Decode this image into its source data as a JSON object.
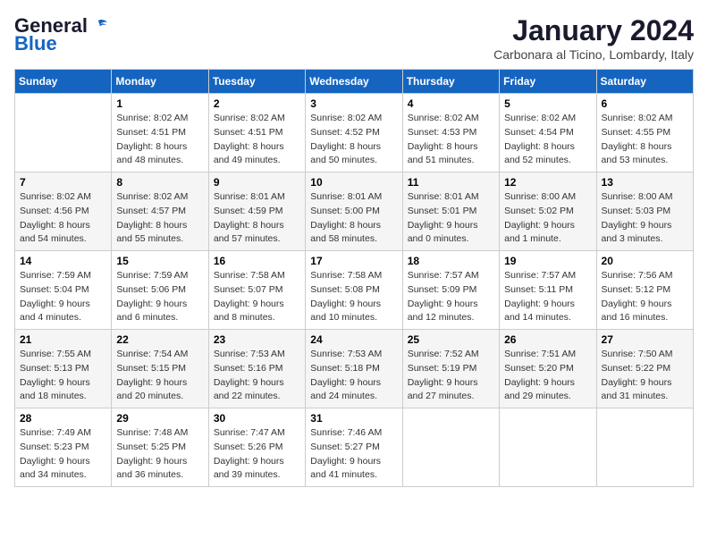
{
  "header": {
    "logo_line1": "General",
    "logo_line2": "Blue",
    "month_title": "January 2024",
    "location": "Carbonara al Ticino, Lombardy, Italy"
  },
  "days_of_week": [
    "Sunday",
    "Monday",
    "Tuesday",
    "Wednesday",
    "Thursday",
    "Friday",
    "Saturday"
  ],
  "weeks": [
    [
      {
        "day": "",
        "sunrise": "",
        "sunset": "",
        "daylight": ""
      },
      {
        "day": "1",
        "sunrise": "8:02 AM",
        "sunset": "4:51 PM",
        "daylight": "8 hours and 48 minutes."
      },
      {
        "day": "2",
        "sunrise": "8:02 AM",
        "sunset": "4:51 PM",
        "daylight": "8 hours and 49 minutes."
      },
      {
        "day": "3",
        "sunrise": "8:02 AM",
        "sunset": "4:52 PM",
        "daylight": "8 hours and 50 minutes."
      },
      {
        "day": "4",
        "sunrise": "8:02 AM",
        "sunset": "4:53 PM",
        "daylight": "8 hours and 51 minutes."
      },
      {
        "day": "5",
        "sunrise": "8:02 AM",
        "sunset": "4:54 PM",
        "daylight": "8 hours and 52 minutes."
      },
      {
        "day": "6",
        "sunrise": "8:02 AM",
        "sunset": "4:55 PM",
        "daylight": "8 hours and 53 minutes."
      }
    ],
    [
      {
        "day": "7",
        "sunrise": "8:02 AM",
        "sunset": "4:56 PM",
        "daylight": "8 hours and 54 minutes."
      },
      {
        "day": "8",
        "sunrise": "8:02 AM",
        "sunset": "4:57 PM",
        "daylight": "8 hours and 55 minutes."
      },
      {
        "day": "9",
        "sunrise": "8:01 AM",
        "sunset": "4:59 PM",
        "daylight": "8 hours and 57 minutes."
      },
      {
        "day": "10",
        "sunrise": "8:01 AM",
        "sunset": "5:00 PM",
        "daylight": "8 hours and 58 minutes."
      },
      {
        "day": "11",
        "sunrise": "8:01 AM",
        "sunset": "5:01 PM",
        "daylight": "9 hours and 0 minutes."
      },
      {
        "day": "12",
        "sunrise": "8:00 AM",
        "sunset": "5:02 PM",
        "daylight": "9 hours and 1 minute."
      },
      {
        "day": "13",
        "sunrise": "8:00 AM",
        "sunset": "5:03 PM",
        "daylight": "9 hours and 3 minutes."
      }
    ],
    [
      {
        "day": "14",
        "sunrise": "7:59 AM",
        "sunset": "5:04 PM",
        "daylight": "9 hours and 4 minutes."
      },
      {
        "day": "15",
        "sunrise": "7:59 AM",
        "sunset": "5:06 PM",
        "daylight": "9 hours and 6 minutes."
      },
      {
        "day": "16",
        "sunrise": "7:58 AM",
        "sunset": "5:07 PM",
        "daylight": "9 hours and 8 minutes."
      },
      {
        "day": "17",
        "sunrise": "7:58 AM",
        "sunset": "5:08 PM",
        "daylight": "9 hours and 10 minutes."
      },
      {
        "day": "18",
        "sunrise": "7:57 AM",
        "sunset": "5:09 PM",
        "daylight": "9 hours and 12 minutes."
      },
      {
        "day": "19",
        "sunrise": "7:57 AM",
        "sunset": "5:11 PM",
        "daylight": "9 hours and 14 minutes."
      },
      {
        "day": "20",
        "sunrise": "7:56 AM",
        "sunset": "5:12 PM",
        "daylight": "9 hours and 16 minutes."
      }
    ],
    [
      {
        "day": "21",
        "sunrise": "7:55 AM",
        "sunset": "5:13 PM",
        "daylight": "9 hours and 18 minutes."
      },
      {
        "day": "22",
        "sunrise": "7:54 AM",
        "sunset": "5:15 PM",
        "daylight": "9 hours and 20 minutes."
      },
      {
        "day": "23",
        "sunrise": "7:53 AM",
        "sunset": "5:16 PM",
        "daylight": "9 hours and 22 minutes."
      },
      {
        "day": "24",
        "sunrise": "7:53 AM",
        "sunset": "5:18 PM",
        "daylight": "9 hours and 24 minutes."
      },
      {
        "day": "25",
        "sunrise": "7:52 AM",
        "sunset": "5:19 PM",
        "daylight": "9 hours and 27 minutes."
      },
      {
        "day": "26",
        "sunrise": "7:51 AM",
        "sunset": "5:20 PM",
        "daylight": "9 hours and 29 minutes."
      },
      {
        "day": "27",
        "sunrise": "7:50 AM",
        "sunset": "5:22 PM",
        "daylight": "9 hours and 31 minutes."
      }
    ],
    [
      {
        "day": "28",
        "sunrise": "7:49 AM",
        "sunset": "5:23 PM",
        "daylight": "9 hours and 34 minutes."
      },
      {
        "day": "29",
        "sunrise": "7:48 AM",
        "sunset": "5:25 PM",
        "daylight": "9 hours and 36 minutes."
      },
      {
        "day": "30",
        "sunrise": "7:47 AM",
        "sunset": "5:26 PM",
        "daylight": "9 hours and 39 minutes."
      },
      {
        "day": "31",
        "sunrise": "7:46 AM",
        "sunset": "5:27 PM",
        "daylight": "9 hours and 41 minutes."
      },
      {
        "day": "",
        "sunrise": "",
        "sunset": "",
        "daylight": ""
      },
      {
        "day": "",
        "sunrise": "",
        "sunset": "",
        "daylight": ""
      },
      {
        "day": "",
        "sunrise": "",
        "sunset": "",
        "daylight": ""
      }
    ]
  ]
}
